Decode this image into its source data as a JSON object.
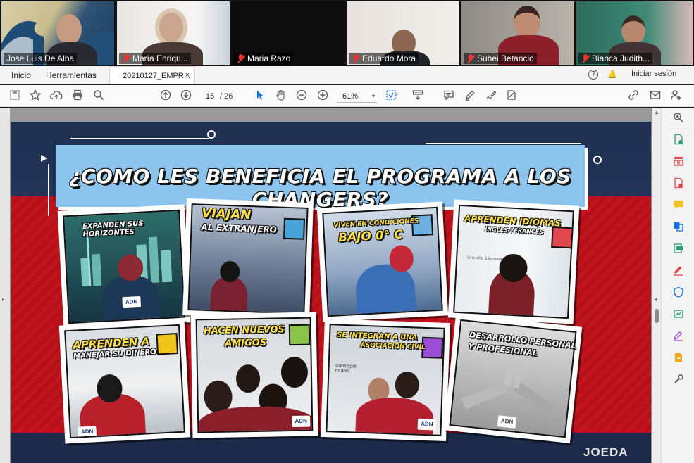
{
  "participants": [
    {
      "name": "Jose Luis De Alba",
      "muted": false
    },
    {
      "name": "María Enriqu...",
      "muted": true
    },
    {
      "name": "Maria Razo",
      "muted": true
    },
    {
      "name": "Eduardo Mora",
      "muted": true
    },
    {
      "name": "Suhei Betancio",
      "muted": true
    },
    {
      "name": "Bianca Judith...",
      "muted": true
    }
  ],
  "menubar": {
    "home": "Inicio",
    "tools": "Herramientas",
    "tab_title": "20210127_EMPR...",
    "tab_close": "×",
    "help": "?",
    "bell": "🔔",
    "sign_in": "Iniciar sesión"
  },
  "toolbar": {
    "page_current": "15",
    "page_total": "/ 26",
    "zoom": "61%",
    "zoom_caret": "▾"
  },
  "slide": {
    "title": "¿COMO LES BENEFICIA EL PROGRAMA A LOS CHANGERS?",
    "brand": "JOEDA",
    "cards": [
      {
        "caption": "EXPANDEN SUS HORIZONTES"
      },
      {
        "caption_a": "VIAJAN",
        "caption_b": "AL EXTRANJERO"
      },
      {
        "caption_a": "VIVEN EN CONDICIONES",
        "caption_b": "BAJO 0° C"
      },
      {
        "caption_a": "APRENDEN IDIOMAS",
        "caption_b": "INGLES / FRANCÉS"
      },
      {
        "caption_a": "APRENDEN A",
        "caption_b": "MANEJAR SU DINERO"
      },
      {
        "caption_a": "HACEN NUEVOS",
        "caption_b": "AMIGOS"
      },
      {
        "caption_a": "SE INTEGRAN A UNA",
        "caption_b": "ASOCIACIÓN CIVIL"
      },
      {
        "caption_a": "DESARROLLO PERSONAL",
        "caption_b": "Y PROFESIONAL"
      }
    ],
    "badge": "ADN",
    "photo_texts": {
      "santropol": "Santropol roulant",
      "screen_heading": "Une ville à la mode"
    }
  },
  "colors": {
    "slide_red": "#c1141c",
    "slide_navy": "#1f3050",
    "title_blue": "#8dc4ee",
    "caption_yellow": "#ffe04a",
    "accent_blue": "#1473e6",
    "active_speaker": "#d8e64a"
  }
}
